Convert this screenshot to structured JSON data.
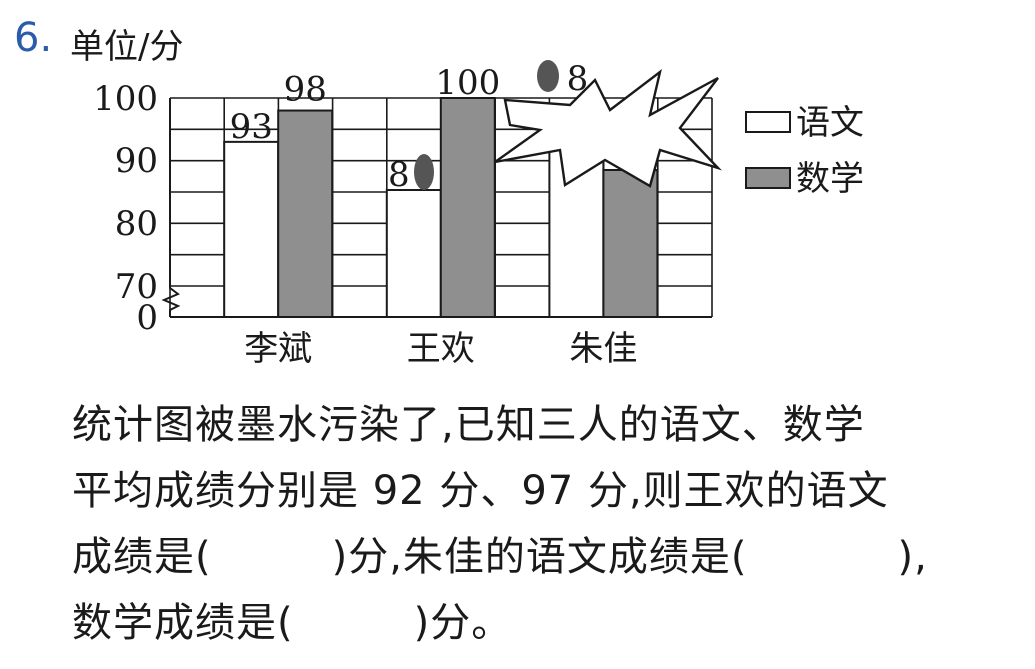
{
  "question": {
    "number": "6.",
    "lines": [
      {
        "pre": "统计图被墨水污染了,已知三人的语文、数学"
      },
      {
        "pre": "平均成绩分别是 92 分、97 分,则王欢的语文"
      },
      {
        "pre": "成绩是(",
        "post": ")分,朱佳的语文成绩是(",
        "post2": "),"
      },
      {
        "pre": "数学成绩是(",
        "post": ")分。"
      }
    ]
  },
  "colors": {
    "chinese_bar": "#ffffff",
    "math_bar": "#8f8f8f",
    "ink": "#555555",
    "outline": "#1a1a1a",
    "number_accent": "#2a5caa"
  },
  "chart_data": {
    "type": "bar",
    "unit_label": "单位/分",
    "categories": [
      "李斌",
      "王欢",
      "朱佳"
    ],
    "series": [
      {
        "name": "语文",
        "values": [
          93,
          null,
          null
        ]
      },
      {
        "name": "数学",
        "values": [
          98,
          100,
          null
        ]
      }
    ],
    "data_labels": [
      {
        "category": "李斌",
        "series": "语文",
        "text": "93"
      },
      {
        "category": "李斌",
        "series": "数学",
        "text": "98"
      },
      {
        "category": "王欢",
        "series": "语文",
        "text": "8"
      },
      {
        "category": "王欢",
        "series": "数学",
        "text": "100"
      },
      {
        "category": "朱佳",
        "series": "语文",
        "text": "8"
      }
    ],
    "yticks": [
      "100",
      "90",
      "80",
      "70",
      "0"
    ],
    "ylim": [
      0,
      100
    ],
    "axis_break": true,
    "grid": true,
    "legend": {
      "placement": "right",
      "entries": [
        "语文",
        "数学"
      ]
    },
    "obscured": [
      "王欢 语文 partly covered by ink blot",
      "朱佳 语文 top covered by ink splash",
      "朱佳 数学 top covered by ink splash"
    ]
  }
}
